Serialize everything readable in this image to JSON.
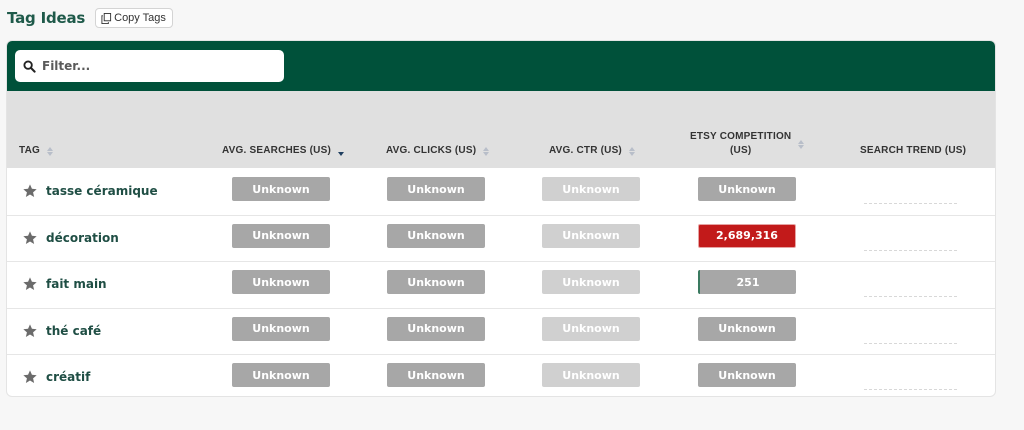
{
  "header": {
    "title": "Tag Ideas",
    "copy_label": "Copy Tags"
  },
  "filter": {
    "placeholder": "Filter..."
  },
  "columns": {
    "tag": "TAG",
    "avg_searches": "AVG. SEARCHES (US)",
    "avg_clicks": "AVG. CLICKS (US)",
    "avg_ctr": "AVG. CTR (US)",
    "etsy_comp_1": "ETSY COMPETITION",
    "etsy_comp_2": "(US)",
    "search_trend": "SEARCH TREND (US)"
  },
  "sort": {
    "active_column": "avg_searches",
    "direction": "descending"
  },
  "rows": [
    {
      "tag": "tasse céramique",
      "searches": "Unknown",
      "clicks": "Unknown",
      "ctr": "Unknown",
      "competition": "Unknown"
    },
    {
      "tag": "décoration",
      "searches": "Unknown",
      "clicks": "Unknown",
      "ctr": "Unknown",
      "competition": "2,689,316"
    },
    {
      "tag": "fait main",
      "searches": "Unknown",
      "clicks": "Unknown",
      "ctr": "Unknown",
      "competition": "251"
    },
    {
      "tag": "thé café",
      "searches": "Unknown",
      "clicks": "Unknown",
      "ctr": "Unknown",
      "competition": "Unknown"
    },
    {
      "tag": "créatif",
      "searches": "Unknown",
      "clicks": "Unknown",
      "ctr": "Unknown",
      "competition": "Unknown"
    }
  ],
  "colors": {
    "brand_green": "#00513a",
    "high_competition": "#c21a1a",
    "unknown_pill": "#a7a7a7"
  }
}
